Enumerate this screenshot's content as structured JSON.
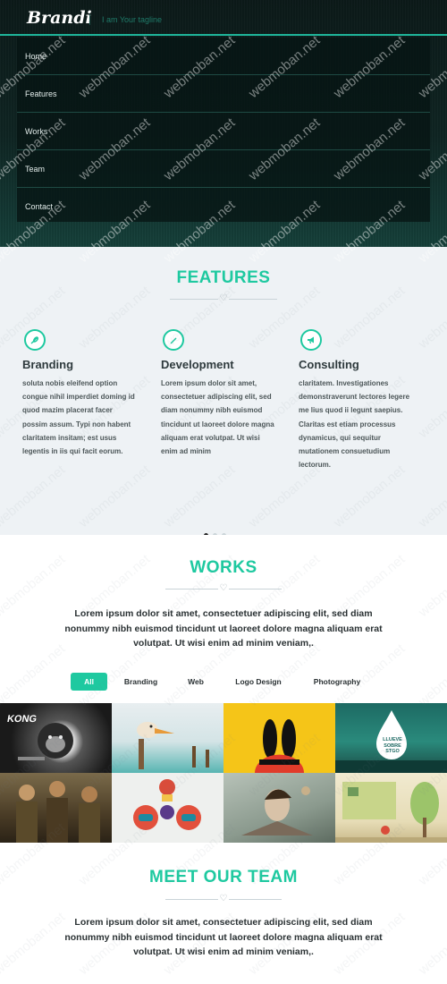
{
  "header": {
    "logo": "Brandi",
    "tagline": "I am Your tagline",
    "nav": [
      "Home",
      "Features",
      "Works",
      "Team",
      "Contact"
    ]
  },
  "watermark": "webmoban.net",
  "features": {
    "title": "FEATURES",
    "items": [
      {
        "icon": "feather-icon",
        "title": "Branding",
        "text": "soluta nobis eleifend option congue nihil imperdiet doming id quod mazim placerat facer possim assum. Typi non habent claritatem insitam; est usus legentis in iis qui facit eorum."
      },
      {
        "icon": "pencil-icon",
        "title": "Development",
        "text": "Lorem ipsum dolor sit amet, consectetuer adipiscing elit, sed diam nonummy nibh euismod tincidunt ut laoreet dolore magna aliquam erat volutpat. Ut wisi enim ad minim"
      },
      {
        "icon": "megaphone-icon",
        "title": "Consulting",
        "text": "claritatem. Investigationes demonstraverunt lectores legere me lius quod ii legunt saepius. Claritas est etiam processus dynamicus, qui sequitur mutationem consuetudium lectorum."
      }
    ],
    "slider_active_index": 0
  },
  "works": {
    "title": "WORKS",
    "intro": "Lorem ipsum dolor sit amet, consectetuer adipiscing elit, sed diam nonummy nibh euismod tincidunt ut laoreet dolore magna aliquam erat volutpat. Ut wisi enim ad minim veniam,.",
    "filters": [
      "All",
      "Branding",
      "Web",
      "Logo Design",
      "Photography"
    ],
    "active_filter": "All",
    "tiles": [
      {
        "name": "gorilla-kong-artwork",
        "caption": "KONG"
      },
      {
        "name": "pelican-beach-illustration",
        "caption": ""
      },
      {
        "name": "bunny-ears-poster",
        "caption": ""
      },
      {
        "name": "drop-poster-stgo",
        "caption": "LLUEVE SOBRE STGO"
      },
      {
        "name": "soldiers-photo",
        "caption": ""
      },
      {
        "name": "robot-characters-illustration",
        "caption": ""
      },
      {
        "name": "surreal-portrait-collage",
        "caption": ""
      },
      {
        "name": "street-cartoon-illustration",
        "caption": ""
      }
    ]
  },
  "team": {
    "title": "MEET OUR TEAM",
    "intro": "Lorem ipsum dolor sit amet, consectetuer adipiscing elit, sed diam nonummy nibh euismod tincidunt ut laoreet dolore magna aliquam erat volutpat. Ut wisi enim ad minim veniam,."
  },
  "colors": {
    "accent": "#1ec9a0",
    "header_bg": "#0f2523",
    "features_bg": "#eef2f5",
    "text_dark": "#2a3133"
  }
}
